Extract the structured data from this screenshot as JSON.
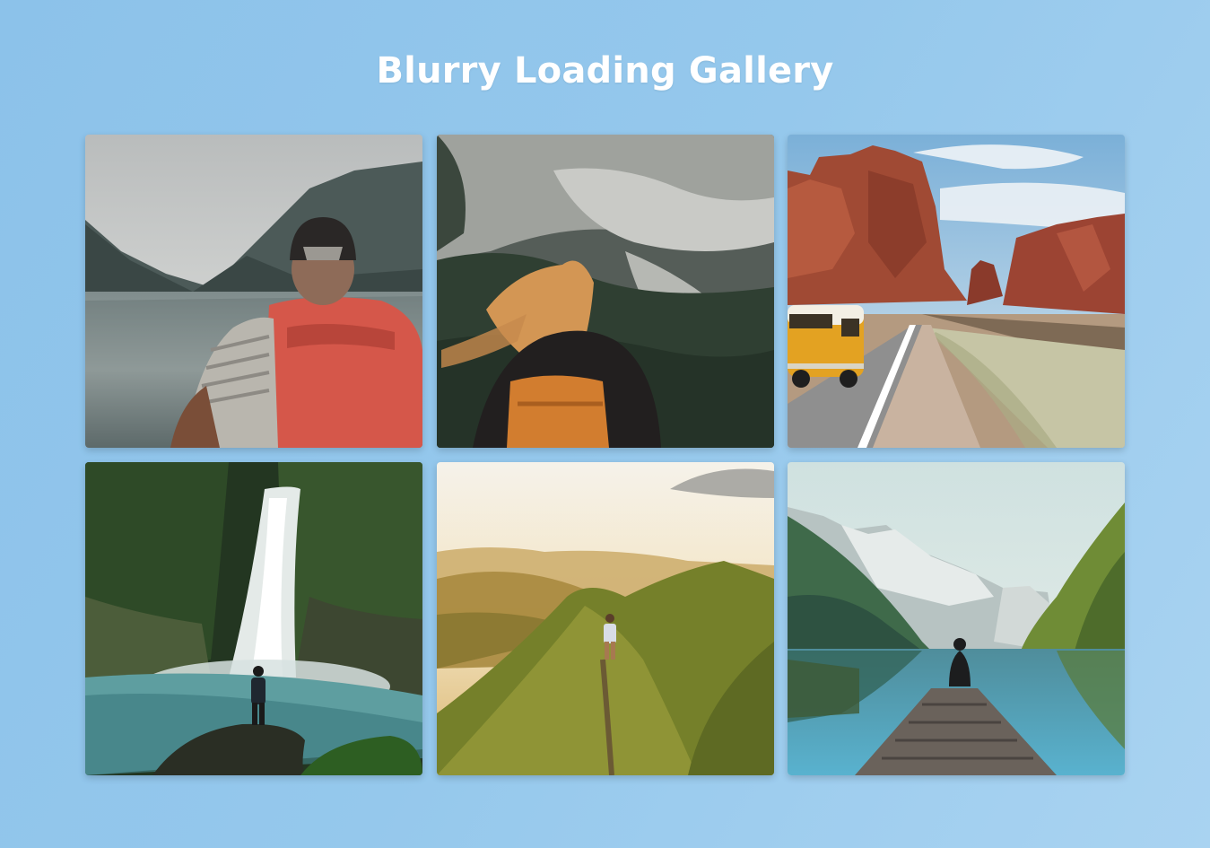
{
  "page": {
    "title": "Blurry Loading Gallery"
  },
  "gallery": {
    "images": [
      {
        "subject": "hiker with red backpack at mountain lake"
      },
      {
        "subject": "woman with orange backpack overlooking forested mountains"
      },
      {
        "subject": "yellow van on desert road near red rock formations"
      },
      {
        "subject": "person standing before waterfall in jungle"
      },
      {
        "subject": "hiker walking along grassy mountain ridge at sunset"
      },
      {
        "subject": "person sitting on wooden dock at alpine lake"
      }
    ]
  },
  "colors": {
    "background_start": "#8cc2ea",
    "background_end": "#a9d3f1",
    "title_text": "#ffffff"
  }
}
